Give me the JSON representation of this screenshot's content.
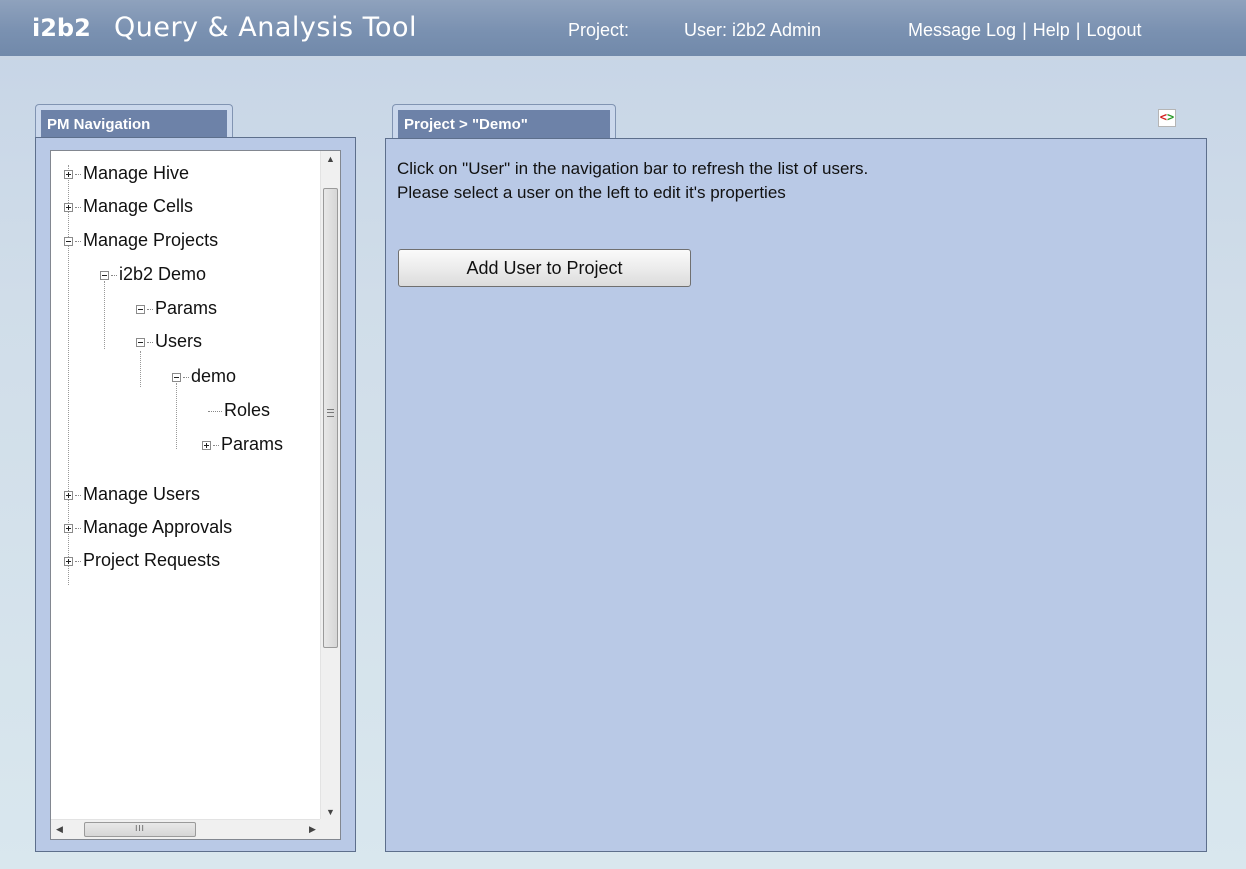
{
  "header": {
    "logo_bold": "i2b2",
    "logo_rest": "Query & Analysis Tool",
    "project_label": "Project:",
    "user_label": "User: i2b2 Admin",
    "message_log": "Message Log",
    "help": "Help",
    "logout": "Logout",
    "separator": "|"
  },
  "left_panel": {
    "tab_title": "PM Navigation",
    "tree": {
      "manage_hive": "Manage Hive",
      "manage_cells": "Manage Cells",
      "manage_projects": "Manage Projects",
      "i2b2_demo": "i2b2 Demo",
      "params": "Params",
      "users": "Users",
      "demo": "demo",
      "roles": "Roles",
      "user_params": "Params",
      "manage_users": "Manage Users",
      "manage_approvals": "Manage Approvals",
      "project_requests": "Project Requests"
    },
    "hscroll_grip": "III"
  },
  "right_panel": {
    "tab_title": "Project > \"Demo\"",
    "line1": "Click on \"User\" in the navigation bar to refresh the list of users.",
    "line2": "Please select a user on the left to edit it's properties",
    "add_user_button": "Add User to Project"
  },
  "icons": {
    "expand": "plus-box-icon",
    "collapse": "minus-box-icon",
    "code_view": "code-view-icon"
  },
  "colors": {
    "header": "#7a91b1",
    "tab": "#6d82a8",
    "panel_background": "#b9c9e6"
  }
}
